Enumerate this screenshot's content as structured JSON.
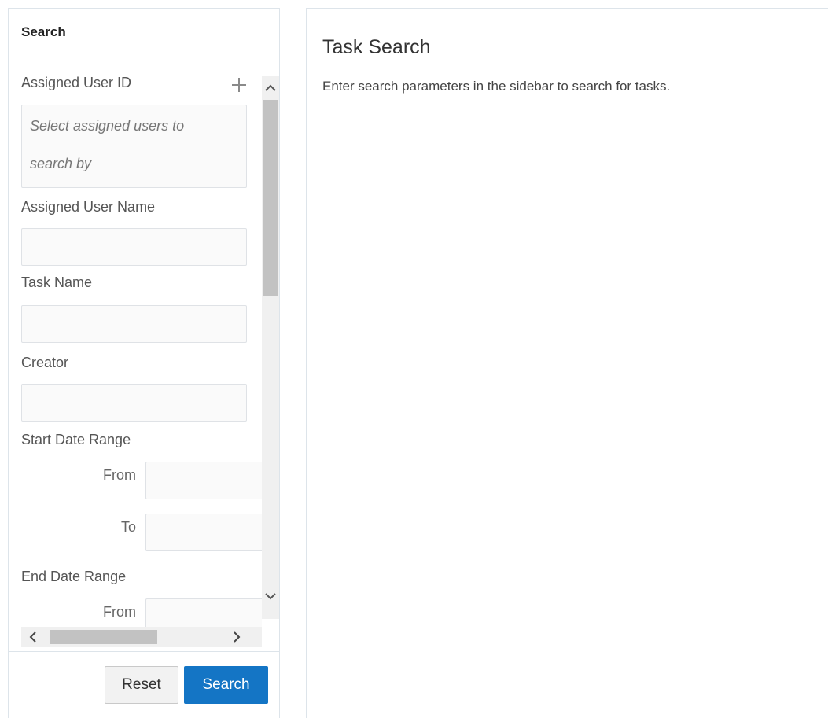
{
  "sidebar": {
    "title": "Search",
    "fields": {
      "assigned_user_id": {
        "label": "Assigned User ID",
        "placeholder_line1": "Select assigned users to",
        "placeholder_line2": "search by"
      },
      "assigned_user_name": {
        "label": "Assigned User Name",
        "value": ""
      },
      "task_name": {
        "label": "Task Name",
        "value": ""
      },
      "creator": {
        "label": "Creator",
        "value": ""
      },
      "start_date_range": {
        "label": "Start Date Range",
        "from_label": "From",
        "to_label": "To"
      },
      "end_date_range": {
        "label": "End Date Range",
        "from_label": "From"
      }
    },
    "buttons": {
      "reset": "Reset",
      "search": "Search"
    }
  },
  "main": {
    "title": "Task Search",
    "description": "Enter search parameters in the sidebar to search for tasks."
  },
  "icons": {
    "add": "plus-icon",
    "scroll_up": "chevron-up-icon",
    "scroll_down": "chevron-down-icon",
    "scroll_left": "chevron-left-icon",
    "scroll_right": "chevron-right-icon"
  },
  "colors": {
    "primary_button": "#1475c5",
    "border": "#dde4ea",
    "input_background": "#fafafa"
  }
}
